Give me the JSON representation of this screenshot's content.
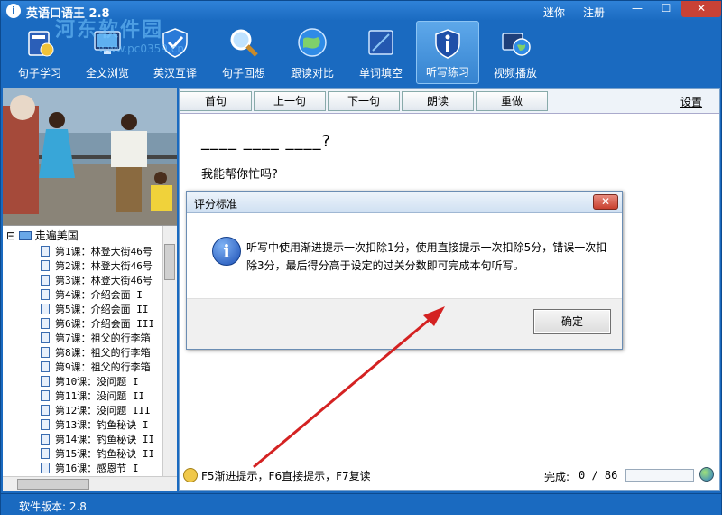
{
  "window": {
    "title": "英语口语王 2.8",
    "watermark": "河东软件园",
    "watermark_url": "www.pc0359.cn",
    "links": [
      "迷你",
      "注册"
    ],
    "controls": {
      "minimize": "—",
      "maximize": "☐",
      "close": "✕"
    }
  },
  "toolbar": {
    "items": [
      {
        "label": "句子学习",
        "icon": "book-icon"
      },
      {
        "label": "全文浏览",
        "icon": "monitor-icon"
      },
      {
        "label": "英汉互译",
        "icon": "shield-check-icon"
      },
      {
        "label": "句子回想",
        "icon": "magnifier-icon"
      },
      {
        "label": "跟读对比",
        "icon": "globe-icon"
      },
      {
        "label": "单词填空",
        "icon": "box-icon"
      },
      {
        "label": "听写练习",
        "icon": "info-shield-icon",
        "active": true
      },
      {
        "label": "视频播放",
        "icon": "video-globe-icon"
      }
    ]
  },
  "tree": {
    "root": "走遍美国",
    "items": [
      "第1课：林登大街46号",
      "第2课：林登大街46号",
      "第3课：林登大街46号",
      "第4课：介绍会面 I",
      "第5课：介绍会面 II",
      "第6课：介绍会面 III",
      "第7课：祖父的行李箱",
      "第8课：祖父的行李箱",
      "第9课：祖父的行李箱",
      "第10课：没问题 I",
      "第11课：没问题 II",
      "第12课：没问题 III",
      "第13课：钓鱼秘诀 I",
      "第14课：钓鱼秘诀 II",
      "第15课：钓鱼秘诀 II",
      "第16课：感恩节 I"
    ]
  },
  "nav": {
    "buttons": [
      "首句",
      "上一句",
      "下一句",
      "朗读",
      "重做"
    ],
    "settings": "设置"
  },
  "exercise": {
    "blanks": "____ ____ ____?",
    "translation": "我能帮你忙吗?"
  },
  "hint": {
    "text": "F5渐进提示，F6直接提示，F7复读"
  },
  "progress": {
    "label": "完成:",
    "value": "0 / 86",
    "fraction": 0
  },
  "status": {
    "text": "软件版本: 2.8"
  },
  "dialog": {
    "title": "评分标准",
    "close": "✕",
    "message": "听写中使用渐进提示一次扣除1分，使用直接提示一次扣除5分，错误一次扣除3分，最后得分高于设定的过关分数即可完成本句听写。",
    "ok": "确定"
  },
  "colors": {
    "frame": "#1a6ac0",
    "accent": "#3c8be0",
    "arrow": "#d42222"
  }
}
